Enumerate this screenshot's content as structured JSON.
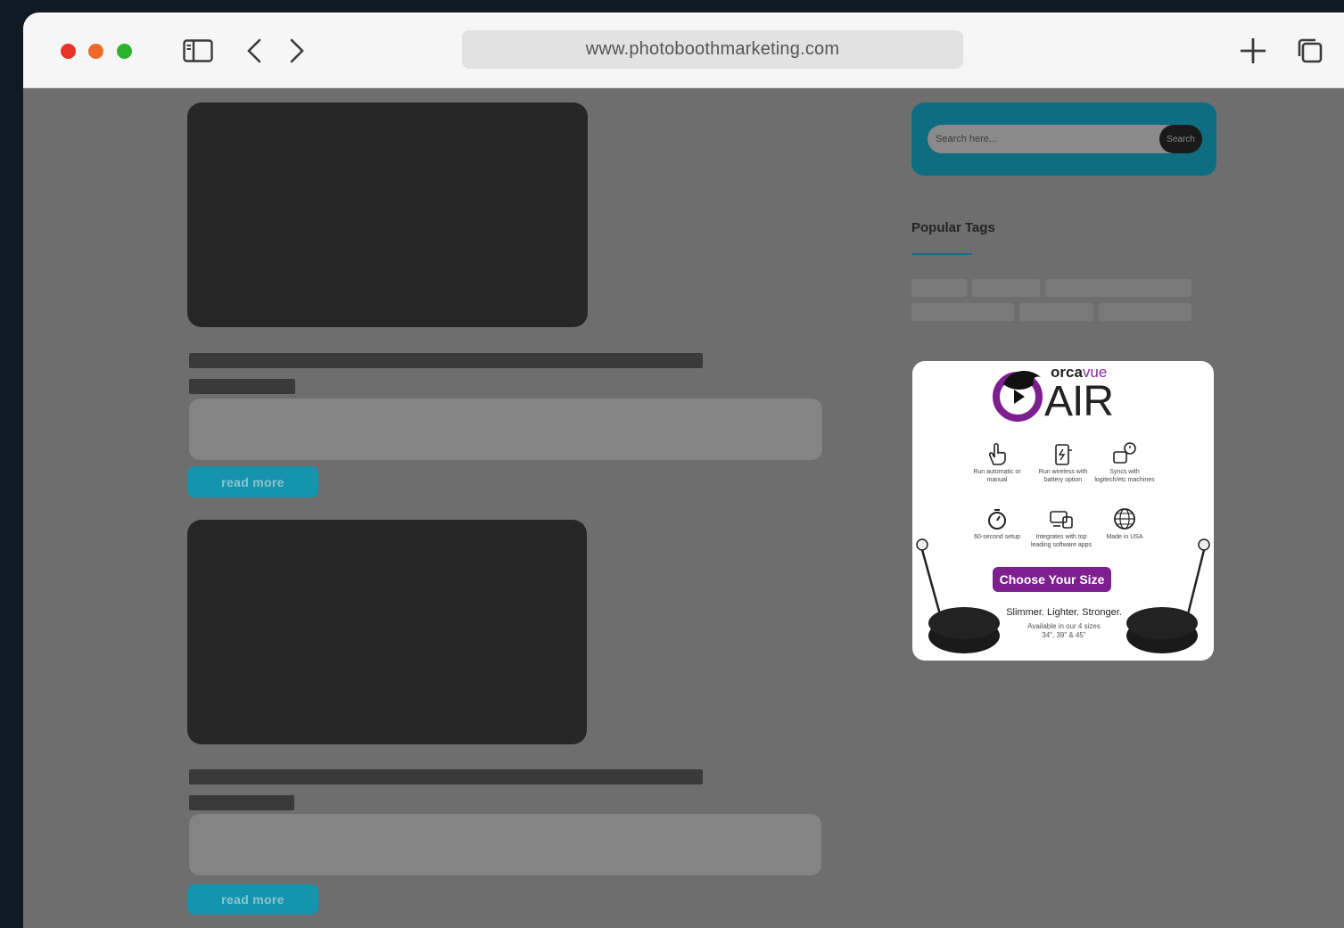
{
  "browser": {
    "url": "www.photoboothmarketing.com",
    "icons": [
      "sidebar-icon",
      "back-icon",
      "forward-icon",
      "new-tab-icon",
      "tabs-overview-icon"
    ]
  },
  "posts": [
    {
      "read_more": "read more"
    },
    {
      "read_more": "read more"
    }
  ],
  "sidebar": {
    "search": {
      "placeholder": "Search here...",
      "button": "Search"
    },
    "tags": {
      "title": "Popular Tags"
    },
    "ad": {
      "brand_prefix": "orca",
      "brand_suffix": "vue",
      "product": "AIR",
      "features": [
        {
          "icon": "touch-icon",
          "text": "Run automatic or manual"
        },
        {
          "icon": "battery-icon",
          "text": "Run wireless with battery option"
        },
        {
          "icon": "sync-icon",
          "text": "Syncs with logitech/etc machines"
        },
        {
          "icon": "stopwatch-icon",
          "text": "60-second setup"
        },
        {
          "icon": "software-icon",
          "text": "Integrates with top leading software apps"
        },
        {
          "icon": "globe-icon",
          "text": "Made in USA"
        }
      ],
      "cta": "Choose Your Size",
      "tagline": "Slimmer. Lighter. Stronger.",
      "sizes_line1": "Available in our 4 sizes",
      "sizes_line2": "34\", 39\" & 45\""
    }
  },
  "colors": {
    "accent": "#1494ad",
    "search_panel": "#0f6d82",
    "cta": "#7d1f8f",
    "mac_red": "#e8332a",
    "mac_yellow": "#ec6b2a",
    "mac_green": "#2bb52f"
  }
}
